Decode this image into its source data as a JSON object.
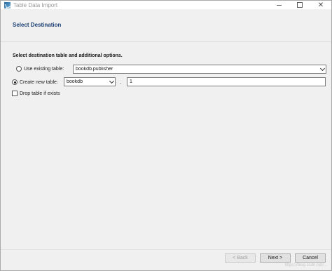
{
  "window": {
    "title": "Table Data Import",
    "controls": {
      "minimize": "",
      "maximize": "",
      "close": "✕"
    }
  },
  "header": {
    "title": "Select Destination"
  },
  "section": {
    "label": "Select destination table and additional options."
  },
  "use_existing": {
    "label": "Use existing table:",
    "selected": false,
    "value": "bookdb.publisher"
  },
  "create_new": {
    "label": "Create new table:",
    "selected": true,
    "schema": "bookdb",
    "separator": ".",
    "table_name": "1"
  },
  "drop_table": {
    "label": "Drop table if exists",
    "checked": false
  },
  "buttons": {
    "back": "< Back",
    "next": "Next >",
    "cancel": "Cancel"
  },
  "watermark": "https://blog.csdn.net/..."
}
